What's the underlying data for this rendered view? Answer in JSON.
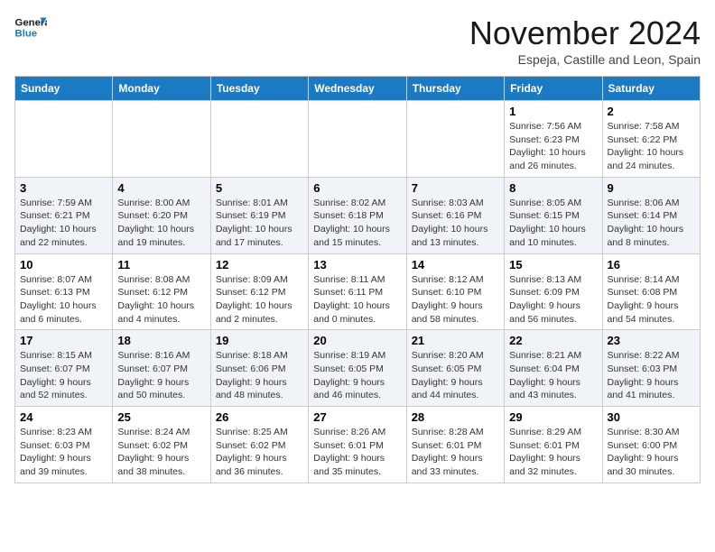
{
  "header": {
    "logo_general": "General",
    "logo_blue": "Blue",
    "month": "November 2024",
    "location": "Espeja, Castille and Leon, Spain"
  },
  "weekdays": [
    "Sunday",
    "Monday",
    "Tuesday",
    "Wednesday",
    "Thursday",
    "Friday",
    "Saturday"
  ],
  "weeks": [
    [
      {
        "day": "",
        "info": ""
      },
      {
        "day": "",
        "info": ""
      },
      {
        "day": "",
        "info": ""
      },
      {
        "day": "",
        "info": ""
      },
      {
        "day": "",
        "info": ""
      },
      {
        "day": "1",
        "info": "Sunrise: 7:56 AM\nSunset: 6:23 PM\nDaylight: 10 hours\nand 26 minutes."
      },
      {
        "day": "2",
        "info": "Sunrise: 7:58 AM\nSunset: 6:22 PM\nDaylight: 10 hours\nand 24 minutes."
      }
    ],
    [
      {
        "day": "3",
        "info": "Sunrise: 7:59 AM\nSunset: 6:21 PM\nDaylight: 10 hours\nand 22 minutes."
      },
      {
        "day": "4",
        "info": "Sunrise: 8:00 AM\nSunset: 6:20 PM\nDaylight: 10 hours\nand 19 minutes."
      },
      {
        "day": "5",
        "info": "Sunrise: 8:01 AM\nSunset: 6:19 PM\nDaylight: 10 hours\nand 17 minutes."
      },
      {
        "day": "6",
        "info": "Sunrise: 8:02 AM\nSunset: 6:18 PM\nDaylight: 10 hours\nand 15 minutes."
      },
      {
        "day": "7",
        "info": "Sunrise: 8:03 AM\nSunset: 6:16 PM\nDaylight: 10 hours\nand 13 minutes."
      },
      {
        "day": "8",
        "info": "Sunrise: 8:05 AM\nSunset: 6:15 PM\nDaylight: 10 hours\nand 10 minutes."
      },
      {
        "day": "9",
        "info": "Sunrise: 8:06 AM\nSunset: 6:14 PM\nDaylight: 10 hours\nand 8 minutes."
      }
    ],
    [
      {
        "day": "10",
        "info": "Sunrise: 8:07 AM\nSunset: 6:13 PM\nDaylight: 10 hours\nand 6 minutes."
      },
      {
        "day": "11",
        "info": "Sunrise: 8:08 AM\nSunset: 6:12 PM\nDaylight: 10 hours\nand 4 minutes."
      },
      {
        "day": "12",
        "info": "Sunrise: 8:09 AM\nSunset: 6:12 PM\nDaylight: 10 hours\nand 2 minutes."
      },
      {
        "day": "13",
        "info": "Sunrise: 8:11 AM\nSunset: 6:11 PM\nDaylight: 10 hours\nand 0 minutes."
      },
      {
        "day": "14",
        "info": "Sunrise: 8:12 AM\nSunset: 6:10 PM\nDaylight: 9 hours\nand 58 minutes."
      },
      {
        "day": "15",
        "info": "Sunrise: 8:13 AM\nSunset: 6:09 PM\nDaylight: 9 hours\nand 56 minutes."
      },
      {
        "day": "16",
        "info": "Sunrise: 8:14 AM\nSunset: 6:08 PM\nDaylight: 9 hours\nand 54 minutes."
      }
    ],
    [
      {
        "day": "17",
        "info": "Sunrise: 8:15 AM\nSunset: 6:07 PM\nDaylight: 9 hours\nand 52 minutes."
      },
      {
        "day": "18",
        "info": "Sunrise: 8:16 AM\nSunset: 6:07 PM\nDaylight: 9 hours\nand 50 minutes."
      },
      {
        "day": "19",
        "info": "Sunrise: 8:18 AM\nSunset: 6:06 PM\nDaylight: 9 hours\nand 48 minutes."
      },
      {
        "day": "20",
        "info": "Sunrise: 8:19 AM\nSunset: 6:05 PM\nDaylight: 9 hours\nand 46 minutes."
      },
      {
        "day": "21",
        "info": "Sunrise: 8:20 AM\nSunset: 6:05 PM\nDaylight: 9 hours\nand 44 minutes."
      },
      {
        "day": "22",
        "info": "Sunrise: 8:21 AM\nSunset: 6:04 PM\nDaylight: 9 hours\nand 43 minutes."
      },
      {
        "day": "23",
        "info": "Sunrise: 8:22 AM\nSunset: 6:03 PM\nDaylight: 9 hours\nand 41 minutes."
      }
    ],
    [
      {
        "day": "24",
        "info": "Sunrise: 8:23 AM\nSunset: 6:03 PM\nDaylight: 9 hours\nand 39 minutes."
      },
      {
        "day": "25",
        "info": "Sunrise: 8:24 AM\nSunset: 6:02 PM\nDaylight: 9 hours\nand 38 minutes."
      },
      {
        "day": "26",
        "info": "Sunrise: 8:25 AM\nSunset: 6:02 PM\nDaylight: 9 hours\nand 36 minutes."
      },
      {
        "day": "27",
        "info": "Sunrise: 8:26 AM\nSunset: 6:01 PM\nDaylight: 9 hours\nand 35 minutes."
      },
      {
        "day": "28",
        "info": "Sunrise: 8:28 AM\nSunset: 6:01 PM\nDaylight: 9 hours\nand 33 minutes."
      },
      {
        "day": "29",
        "info": "Sunrise: 8:29 AM\nSunset: 6:01 PM\nDaylight: 9 hours\nand 32 minutes."
      },
      {
        "day": "30",
        "info": "Sunrise: 8:30 AM\nSunset: 6:00 PM\nDaylight: 9 hours\nand 30 minutes."
      }
    ]
  ]
}
